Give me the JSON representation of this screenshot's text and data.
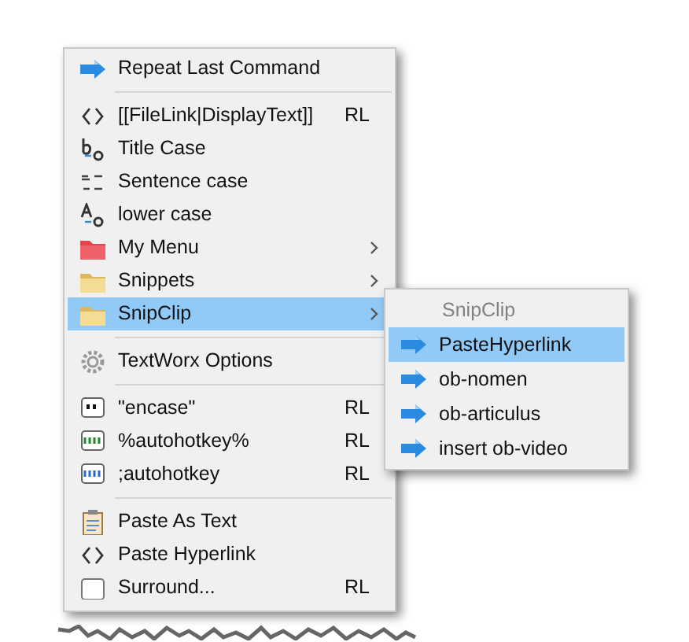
{
  "menu": {
    "items": [
      {
        "kind": "command",
        "label": "Repeat Last Command",
        "selected": false
      },
      {
        "kind": "separator"
      },
      {
        "kind": "command",
        "label": "[[FileLink|DisplayText]]",
        "shortcut": "RL",
        "selected": false
      },
      {
        "kind": "command",
        "label": "Title Case",
        "selected": false
      },
      {
        "kind": "command",
        "label": "Sentence case",
        "selected": false
      },
      {
        "kind": "command",
        "label": "lower case",
        "selected": false
      },
      {
        "kind": "submenu",
        "label": "My Menu",
        "selected": false
      },
      {
        "kind": "submenu",
        "label": "Snippets",
        "selected": false
      },
      {
        "kind": "submenu",
        "label": "SnipClip",
        "selected": true
      },
      {
        "kind": "separator"
      },
      {
        "kind": "command",
        "label": "TextWorx Options",
        "selected": false
      },
      {
        "kind": "separator"
      },
      {
        "kind": "command",
        "label": "\"encase\"",
        "shortcut": "RL",
        "selected": false
      },
      {
        "kind": "command",
        "label": "%autohotkey%",
        "shortcut": "RL",
        "selected": false
      },
      {
        "kind": "command",
        "label": ";autohotkey",
        "shortcut": "RL",
        "selected": false
      },
      {
        "kind": "separator"
      },
      {
        "kind": "command",
        "label": "Paste As Text",
        "selected": false
      },
      {
        "kind": "command",
        "label": "Paste Hyperlink",
        "selected": false
      },
      {
        "kind": "command",
        "label": "Surround...",
        "shortcut": "RL",
        "selected": false
      }
    ]
  },
  "submenu": {
    "title": "SnipClip",
    "items": [
      {
        "label": "PasteHyperlink",
        "selected": true
      },
      {
        "label": "ob-nomen",
        "selected": false
      },
      {
        "label": "ob-articulus",
        "selected": false
      },
      {
        "label": "insert ob-video",
        "selected": false
      }
    ]
  }
}
